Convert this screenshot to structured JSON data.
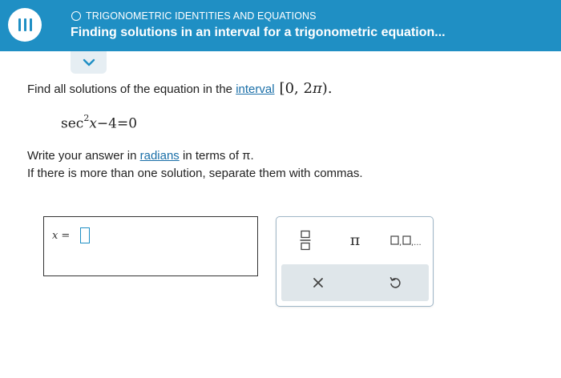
{
  "header": {
    "topic": "TRIGONOMETRIC IDENTITIES AND EQUATIONS",
    "title": "Finding solutions in an interval for a trigonometric equation..."
  },
  "problem": {
    "instruction_text": "Find all solutions of the equation in the",
    "interval_link": "interval",
    "interval_math": {
      "open": "[",
      "start": "0,",
      "end": "2",
      "pi": "π",
      "close": ")."
    },
    "equation": {
      "func": "sec",
      "power": "2",
      "var": "x",
      "rest": "−4=0"
    },
    "line1_before": "Write your answer in",
    "line1_link": "radians",
    "line1_after": "in terms of π.",
    "line2": "If there is more than one solution, separate them with commas."
  },
  "answer": {
    "label_var": "x",
    "label_eq": "=",
    "value": ""
  },
  "keypad": {
    "pi_label": "π",
    "list_label": "□,□,...",
    "clear_label": "×"
  },
  "colors": {
    "header_bg": "#1f8fc4",
    "link": "#1a6fa8",
    "input_border": "#1f8fc4"
  }
}
